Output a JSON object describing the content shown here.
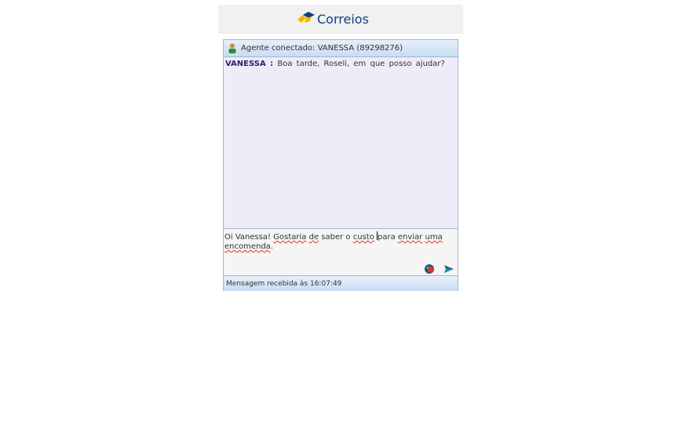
{
  "header": {
    "brand": "Correios",
    "logo_icon": "correios-logo-icon",
    "colors": {
      "brand_blue": "#0d3f86",
      "brand_yellow": "#f5b800"
    }
  },
  "agent_bar": {
    "icon": "agent-person-icon",
    "text": "Agente conectado: VANESSA (89298276)"
  },
  "messages": [
    {
      "sender": "VANESSA :",
      "text": "Boa tarde, Roseli, em que posso ajudar?"
    }
  ],
  "input": {
    "value_parts": [
      "Oi Vanessa! ",
      "Gostaria",
      " ",
      "de",
      " saber o ",
      "custo",
      " ",
      "para",
      " ",
      "enviar",
      " ",
      "uma",
      " ",
      "encomenda",
      "."
    ],
    "misspelled_indices": [
      1,
      3,
      5,
      9,
      11,
      13
    ]
  },
  "actions": {
    "emoji_icon": "emoji-icon",
    "send_icon": "send-arrow-icon"
  },
  "status": {
    "text": "Mensagem recebida às 16:07:49"
  },
  "colors": {
    "chat_bg": "#f0ebf9",
    "bar_gradient_top": "#e6f0fa",
    "bar_gradient_bottom": "#c8dcf1",
    "border": "#9db9d6"
  }
}
